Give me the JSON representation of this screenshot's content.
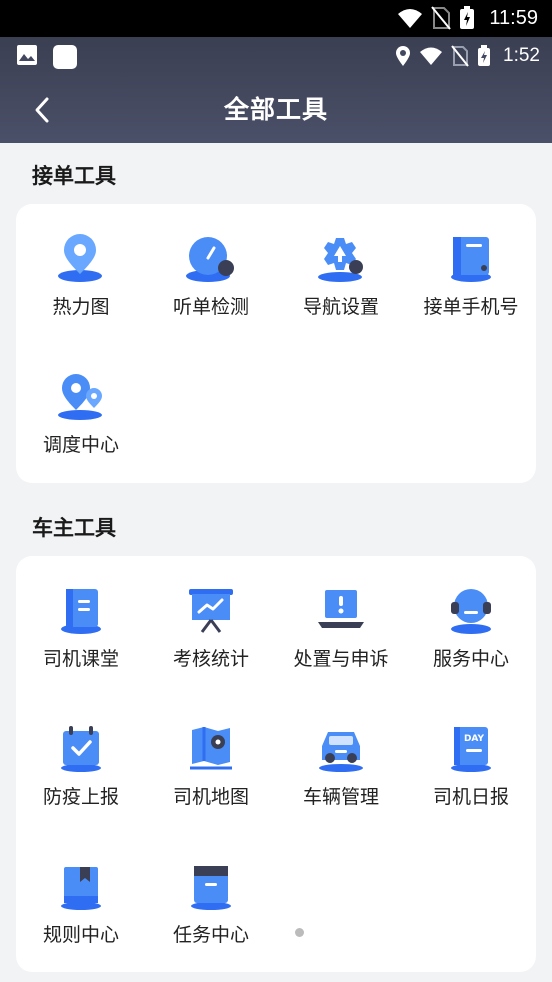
{
  "system_status": {
    "time": "11:59"
  },
  "app_status": {
    "time": "1:52"
  },
  "header": {
    "title": "全部工具"
  },
  "sections": [
    {
      "title": "接单工具",
      "tools": [
        {
          "label": "热力图",
          "icon": "map-pin-icon"
        },
        {
          "label": "听单检测",
          "icon": "gauge-icon"
        },
        {
          "label": "导航设置",
          "icon": "navigation-gear-icon"
        },
        {
          "label": "接单手机号",
          "icon": "phone-card-icon"
        },
        {
          "label": "调度中心",
          "icon": "dispatch-pins-icon"
        }
      ]
    },
    {
      "title": "车主工具",
      "tools": [
        {
          "label": "司机课堂",
          "icon": "book-icon"
        },
        {
          "label": "考核统计",
          "icon": "chart-board-icon"
        },
        {
          "label": "处置与申诉",
          "icon": "alert-laptop-icon"
        },
        {
          "label": "服务中心",
          "icon": "headset-icon"
        },
        {
          "label": "防疫上报",
          "icon": "calendar-check-icon"
        },
        {
          "label": "司机地图",
          "icon": "folded-map-icon"
        },
        {
          "label": "车辆管理",
          "icon": "car-icon"
        },
        {
          "label": "司机日报",
          "icon": "daily-report-icon"
        },
        {
          "label": "规则中心",
          "icon": "bookmark-book-icon"
        },
        {
          "label": "任务中心",
          "icon": "briefcase-icon"
        }
      ]
    }
  ],
  "colors": {
    "accent": "#2f6df2",
    "accent_light": "#6aa8ff",
    "header_bg": "#434860",
    "page_bg": "#f2f3f5"
  },
  "icons": {
    "day_badge": "DAY"
  }
}
